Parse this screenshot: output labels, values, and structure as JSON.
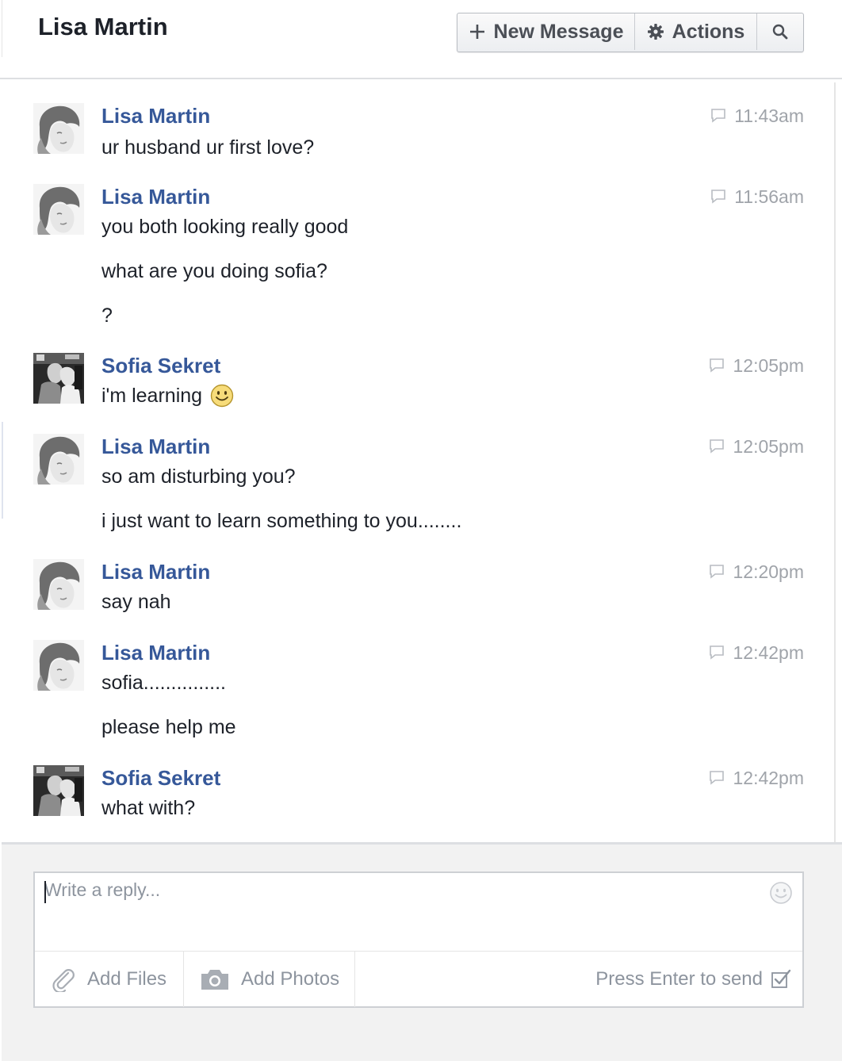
{
  "header": {
    "title": "Lisa Martin",
    "new_message_label": "New Message",
    "actions_label": "Actions"
  },
  "messages": [
    {
      "sender": "Lisa Martin",
      "time": "11:43am",
      "avatar": "lisa-avatar",
      "lines": [
        "ur husband ur first love?"
      ]
    },
    {
      "sender": "Lisa Martin",
      "time": "11:56am",
      "avatar": "lisa-avatar",
      "lines": [
        "you both looking really good",
        "what are you doing sofia?",
        "?"
      ]
    },
    {
      "sender": "Sofia Sekret",
      "time": "12:05pm",
      "avatar": "sofia-avatar",
      "lines": [
        "i'm learning"
      ],
      "emoji": "smiley-emoji"
    },
    {
      "sender": "Lisa Martin",
      "time": "12:05pm",
      "avatar": "lisa-avatar",
      "lines": [
        "so am disturbing you?",
        "i just want to learn something to you........"
      ]
    },
    {
      "sender": "Lisa Martin",
      "time": "12:20pm",
      "avatar": "lisa-avatar",
      "lines": [
        "say nah"
      ]
    },
    {
      "sender": "Lisa Martin",
      "time": "12:42pm",
      "avatar": "lisa-avatar",
      "lines": [
        "sofia...............",
        "please help me"
      ]
    },
    {
      "sender": "Sofia Sekret",
      "time": "12:42pm",
      "avatar": "sofia-avatar",
      "lines": [
        "what with?"
      ]
    }
  ],
  "composer": {
    "placeholder": "Write a reply...",
    "add_files_label": "Add Files",
    "add_photos_label": "Add Photos",
    "send_hint": "Press Enter to send",
    "press_enter_checked": true
  },
  "colors": {
    "sender_link": "#365899",
    "timestamp": "#a0a4aa",
    "composer_bg": "#f2f2f2"
  }
}
